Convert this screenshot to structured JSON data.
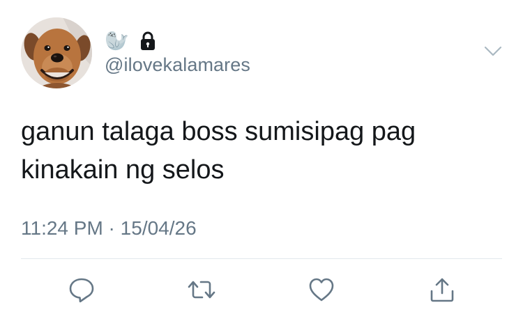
{
  "tweet": {
    "user": {
      "display_emoji": "🦭",
      "handle": "@ilovekalamares",
      "protected_icon": "lock-icon",
      "avatar_icon": "dog-avatar"
    },
    "text_lines": [
      "ganun talaga boss sumisipag pag",
      "kinakain ng selos"
    ],
    "time": "11:24 PM",
    "separator": " · ",
    "date": "15/04/26",
    "menu_icon": "chevron-down-icon",
    "actions": [
      {
        "icon": "reply-icon"
      },
      {
        "icon": "retweet-icon"
      },
      {
        "icon": "like-icon"
      },
      {
        "icon": "share-icon"
      }
    ]
  },
  "colors": {
    "text_primary": "#14171a",
    "text_secondary": "#657786",
    "divider": "#e1e8ed",
    "icon": "#657786"
  }
}
